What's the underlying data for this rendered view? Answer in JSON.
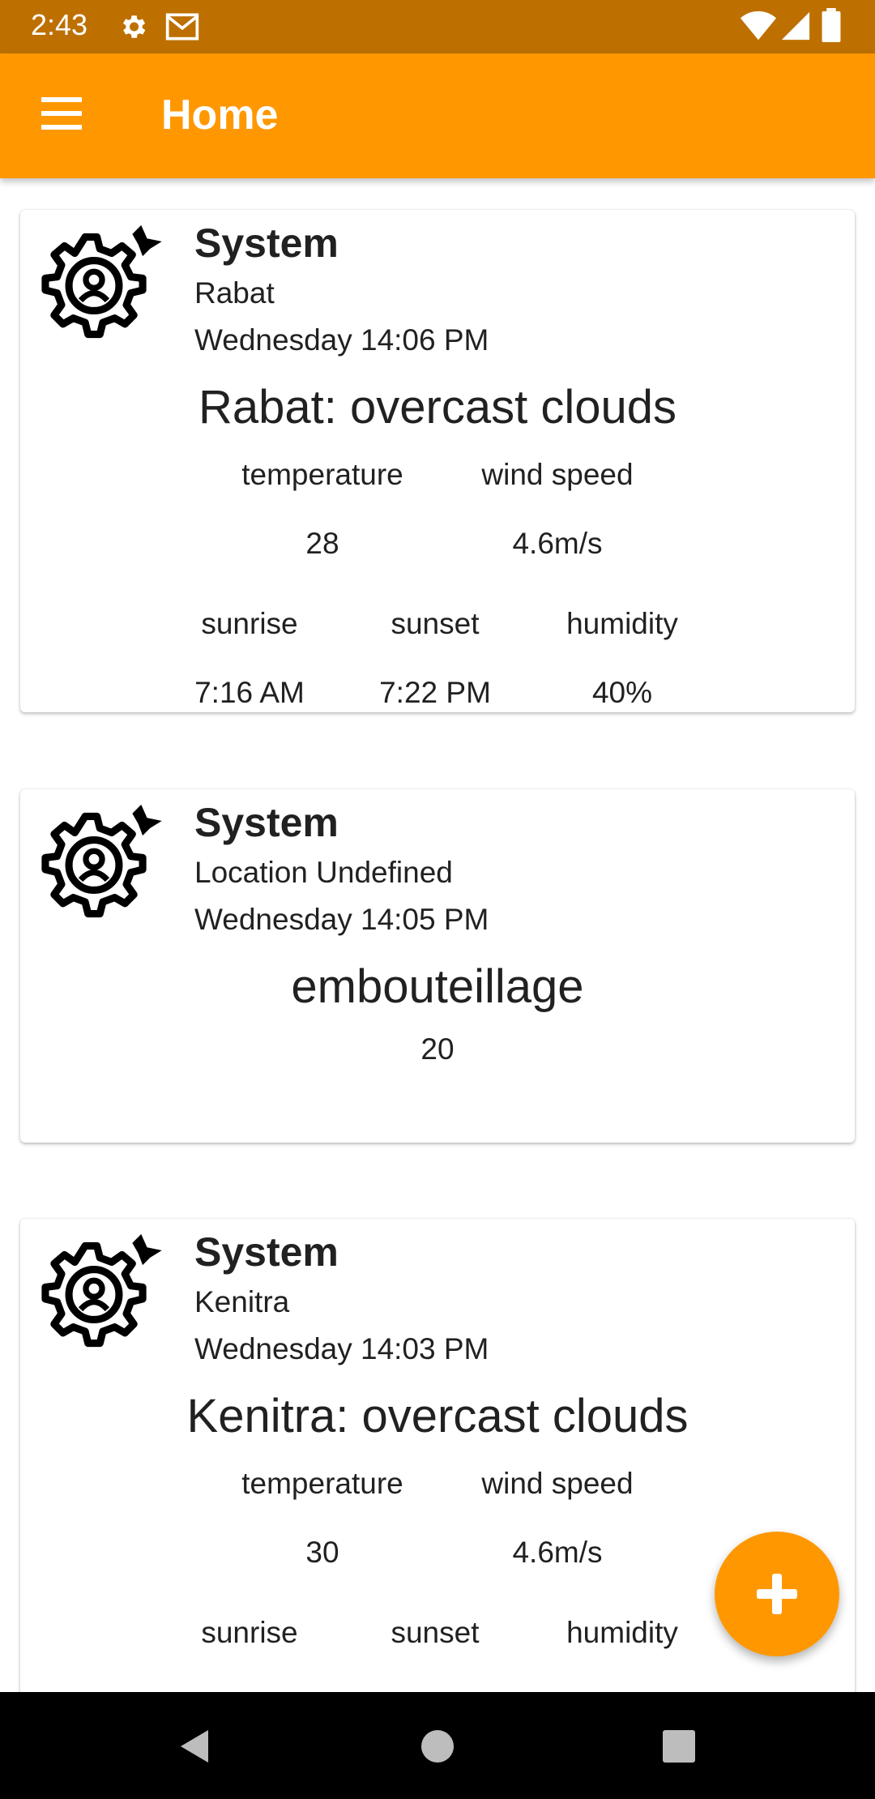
{
  "status_bar": {
    "time": "2:43",
    "icons": [
      "gear-icon",
      "gmail-icon",
      "wifi-icon",
      "signal-icon",
      "battery-icon"
    ]
  },
  "app_bar": {
    "title": "Home",
    "menu_icon": "hamburger-menu-icon",
    "color": "#ff9800"
  },
  "cards": [
    {
      "sender": "System",
      "location": "Rabat",
      "time": "Wednesday 14:06 PM",
      "heading": "Rabat: overcast clouds",
      "labels": {
        "temperature": "temperature",
        "wind_speed": "wind speed",
        "sunrise": "sunrise",
        "sunset": "sunset",
        "humidity": "humidity"
      },
      "values": {
        "temperature": "28",
        "wind_speed": "4.6m/s",
        "sunrise": "7:16 AM",
        "sunset": "7:22 PM",
        "humidity": "40%"
      }
    },
    {
      "sender": "System",
      "location": "Location Undefined",
      "time": "Wednesday 14:05 PM",
      "heading": "embouteillage",
      "value": "20"
    },
    {
      "sender": "System",
      "location": "Kenitra",
      "time": "Wednesday 14:03 PM",
      "heading": "Kenitra: overcast clouds",
      "labels": {
        "temperature": "temperature",
        "wind_speed": "wind speed",
        "sunrise": "sunrise",
        "sunset": "sunset",
        "humidity": "humidity"
      },
      "values": {
        "temperature": "30",
        "wind_speed": "4.6m/s"
      }
    }
  ],
  "fab": {
    "icon": "plus-icon",
    "color": "#ff9800"
  },
  "nav_bar": {
    "icons": [
      "back-icon",
      "home-icon",
      "recents-icon"
    ]
  }
}
